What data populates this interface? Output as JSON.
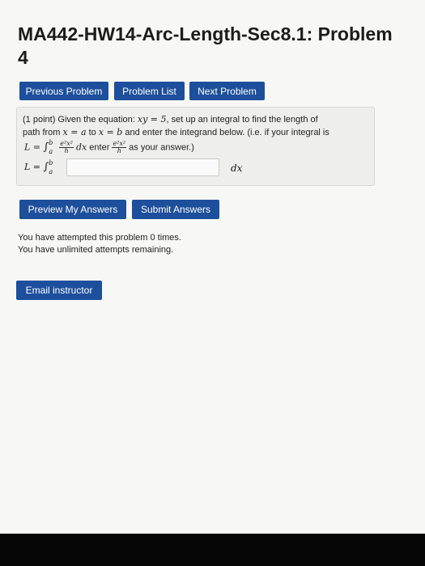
{
  "header": {
    "title": "MA442-HW14-Arc-Length-Sec8.1: Problem 4"
  },
  "nav": {
    "previous_label": "Previous Problem",
    "list_label": "Problem List",
    "next_label": "Next Problem"
  },
  "problem": {
    "points": "(1 point)",
    "line1_a": "Given the equation: ",
    "equation": "xy = 5",
    "line1_b": ", set up an integral to find the length of",
    "line2_a": "path from ",
    "from_expr": "x = a",
    "line2_b": " to ",
    "to_expr": "x = b",
    "line2_c": " and enter the integrand below. (i.e. if your integral is",
    "example_lhs": "L = ",
    "integral_sign": "∫",
    "lower_limit": "a",
    "upper_limit": "b",
    "frac_num": "e²x²",
    "frac_den": "h",
    "dx": "dx",
    "enter_word": " enter ",
    "as_answer": " as your answer.)",
    "answer_lhs": "L = ",
    "answer_value": "",
    "answer_suffix": "dx"
  },
  "actions": {
    "preview_label": "Preview My Answers",
    "submit_label": "Submit Answers"
  },
  "status": {
    "attempts": "You have attempted this problem 0 times.",
    "remaining": "You have unlimited attempts remaining."
  },
  "contact": {
    "email_label": "Email instructor"
  }
}
